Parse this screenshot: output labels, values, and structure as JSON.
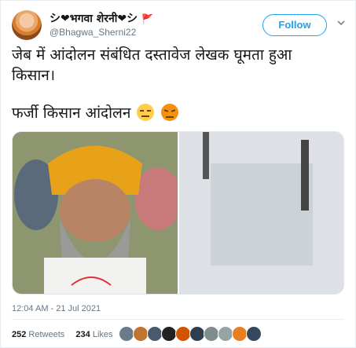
{
  "user": {
    "display_name": "̏❤️भगवा शेरनी❤️̏",
    "display_name_text": "シ❤भगवा शेरनी❤シ",
    "handle": "@Bhagwa_Sherni22",
    "flag": "🚩"
  },
  "follow_label": "Follow",
  "tweet": {
    "line1": "जेब में आंदोलन संबंधित दस्तावेज लेखक घूमता हुआ",
    "line2": "किसान।",
    "line3": "फर्जी किसान आंदोलन"
  },
  "emojis": [
    "unamused-face",
    "angry-face"
  ],
  "timestamp": "12:04 AM - 21 Jul 2021",
  "stats": {
    "retweets_count": "252",
    "retweets_label": "Retweets",
    "likes_count": "234",
    "likes_label": "Likes"
  },
  "liker_colors": [
    "#6b7b8c",
    "#c0742d",
    "#4a5a6a",
    "#222222",
    "#d35400",
    "#2c3e50",
    "#7f8c8d",
    "#95a5a6",
    "#e67e22",
    "#34495e"
  ],
  "colors": {
    "accent": "#1da1f2",
    "text": "#14171a",
    "muted": "#657786",
    "border": "#e6ecf0"
  }
}
